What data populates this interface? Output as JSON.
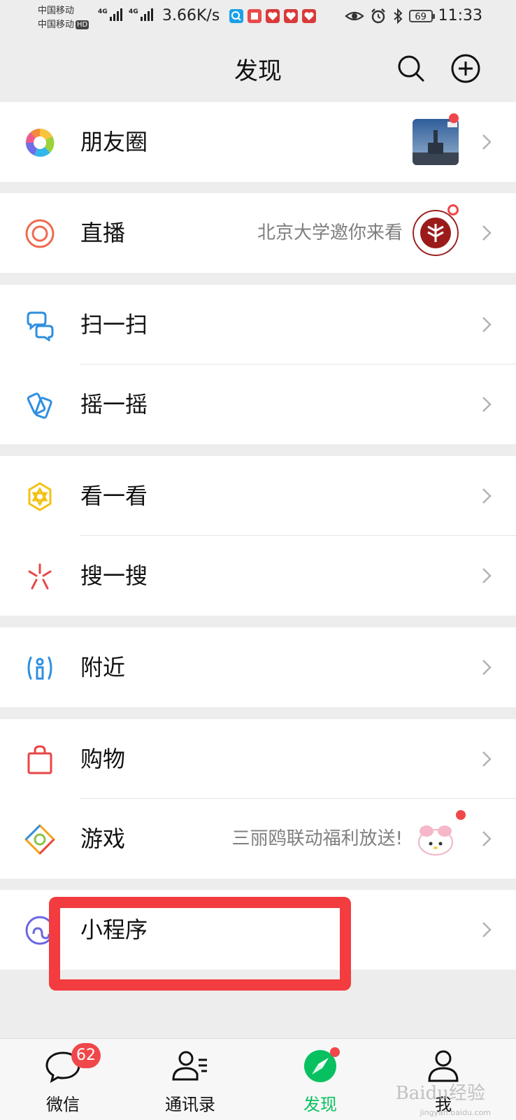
{
  "status_bar": {
    "carrier_1": "中国移动",
    "carrier_2": "中国移动",
    "hd_badge": "HD",
    "signal_tag_1": "4G",
    "signal_tag_2": "4G",
    "net_speed": "3.66K/s",
    "battery": "69",
    "time": "11:33",
    "icons": [
      "eye-icon",
      "alarm-icon",
      "bluetooth-icon"
    ]
  },
  "header": {
    "title": "发现"
  },
  "menu": {
    "moments": {
      "label": "朋友圈"
    },
    "live": {
      "label": "直播",
      "subtitle": "北京大学邀你来看"
    },
    "scan": {
      "label": "扫一扫"
    },
    "shake": {
      "label": "摇一摇"
    },
    "top_stories": {
      "label": "看一看"
    },
    "search": {
      "label": "搜一搜"
    },
    "nearby": {
      "label": "附近"
    },
    "shopping": {
      "label": "购物"
    },
    "games": {
      "label": "游戏",
      "subtitle": "三丽鸥联动福利放送!"
    },
    "mini_programs": {
      "label": "小程序"
    }
  },
  "tabbar": {
    "chats": {
      "label": "微信",
      "badge": "62"
    },
    "contacts": {
      "label": "通讯录"
    },
    "discover": {
      "label": "发现"
    },
    "me": {
      "label": "我"
    }
  },
  "watermark": {
    "text": "Baidu经验",
    "url": "jingyan.baidu.com"
  },
  "colors": {
    "accent_green": "#07c160",
    "badge_red": "#f0474a",
    "highlight_red": "#f23c3f",
    "background": "#ededed"
  }
}
